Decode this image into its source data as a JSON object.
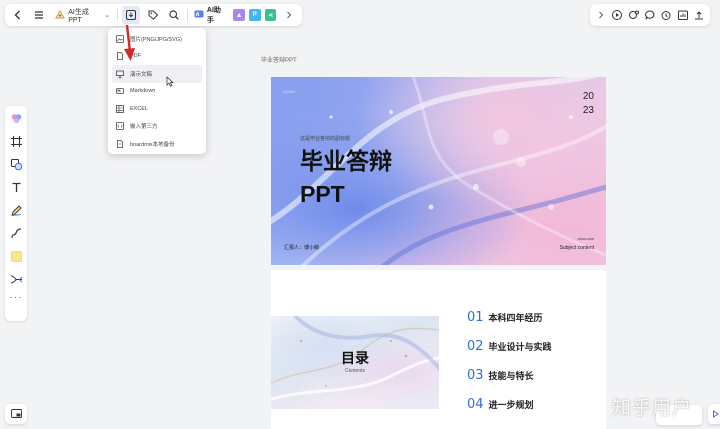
{
  "toolbar": {
    "ai_ppt_label": "AI生成PPT",
    "ai_helper_label": "AI助手",
    "icons": [
      "back-icon",
      "menu-icon",
      "ai-ppt-icon",
      "download-icon",
      "tag-icon",
      "search-icon",
      "image-app-icon",
      "p-app-icon",
      "share-app-icon",
      "chevron-right-icon"
    ]
  },
  "toolbar_right": {
    "icons": [
      "chevron-right-icon",
      "play-icon",
      "collaborate-icon",
      "comment-icon",
      "timer-icon",
      "stats-icon",
      "upload-icon"
    ]
  },
  "export_menu": {
    "items": [
      {
        "label": "图片(PNG/JPG/SVG)",
        "icon": "image-icon"
      },
      {
        "label": "PDF",
        "icon": "pdf-icon"
      },
      {
        "label": "演示文稿",
        "icon": "presentation-icon"
      },
      {
        "label": "Markdown",
        "icon": "markdown-icon"
      },
      {
        "label": "EXCEL",
        "icon": "excel-icon"
      },
      {
        "label": "嵌入第三方",
        "icon": "embed-icon"
      },
      {
        "label": "boardmix本地备份",
        "icon": "backup-icon"
      }
    ]
  },
  "sidebar": {
    "tools": [
      "color-palette-icon",
      "frame-icon",
      "shape-icon",
      "text-icon",
      "pen-icon",
      "connector-icon",
      "sticky-note-icon",
      "mindmap-icon",
      "more-icon"
    ]
  },
  "canvas": {
    "page_label": "毕业答辩PPT",
    "slide1": {
      "logo": "LOGO",
      "year_line1": "20",
      "year_line2": "23",
      "pre_title": "这是毕业答辩的副标题",
      "title_line1": "毕业答辩",
      "title_line2": "PPT",
      "reporter": "汇报人：博小萌",
      "sub_tiny": "xxxxx.com",
      "subject": "Subject content"
    },
    "slide2": {
      "toc_title": "目录",
      "toc_sub": "Contents",
      "items": [
        {
          "num": "01",
          "text": "本科四年经历"
        },
        {
          "num": "02",
          "text": "毕业设计与实践"
        },
        {
          "num": "03",
          "text": "技能与特长"
        },
        {
          "num": "04",
          "text": "进一步规划"
        }
      ]
    }
  },
  "watermark": "知乎用户",
  "colors": {
    "accent_blue": "#2c6fd6",
    "arrow_red": "#d9262a",
    "menu_hover": "#eef0f3"
  }
}
